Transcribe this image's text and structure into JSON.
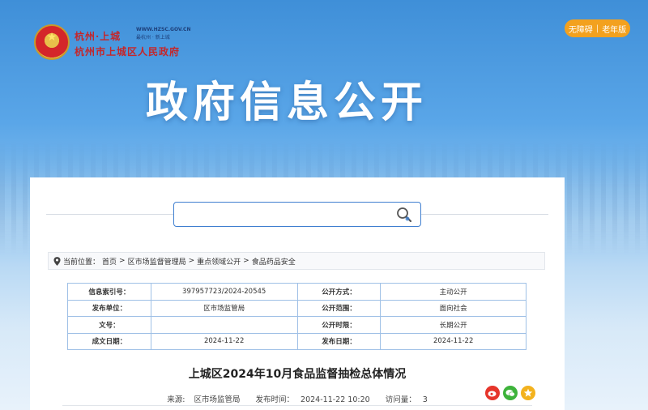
{
  "header": {
    "logo_top": "杭州·上城",
    "logo_url": "WWW.HZSC.GOV.CN",
    "logo_slogan": "最杭州 · 新上城",
    "logo_bottom": "杭州市上城区人民政府",
    "access_label": "无障碍",
    "elder_label": "老年版",
    "banner_title": "政府信息公开"
  },
  "search": {
    "placeholder": "",
    "value": ""
  },
  "breadcrumb": {
    "prefix": "当前位置：",
    "items": [
      "首页",
      "区市场监督管理局",
      "重点领域公开",
      "食品药品安全"
    ],
    "separator": ">"
  },
  "meta_table": [
    {
      "k1": "信息索引号：",
      "v1": "397957723/2024-20545",
      "k2": "公开方式：",
      "v2": "主动公开"
    },
    {
      "k1": "发布单位：",
      "v1": "区市场监管局",
      "k2": "公开范围：",
      "v2": "面向社会"
    },
    {
      "k1": "文号：",
      "v1": "",
      "k2": "公开时限：",
      "v2": "长期公开"
    },
    {
      "k1": "成文日期：",
      "v1": "2024-11-22",
      "k2": "发布日期：",
      "v2": "2024-11-22"
    }
  ],
  "document": {
    "title": "上城区2024年10月食品监督抽检总体情况",
    "source_label": "来源:",
    "source": "区市场监管局",
    "publish_label": "发布时间：",
    "publish_time": "2024-11-22 10:20",
    "visits_label": "访问量：",
    "visits": "3"
  },
  "share_icons": [
    "weibo-icon",
    "wechat-icon",
    "qzone-icon"
  ],
  "colors": {
    "accent": "#3f7fd0",
    "button": "#f3a11e",
    "table_border": "#9fc0e6",
    "logo_red": "#c4262a"
  }
}
